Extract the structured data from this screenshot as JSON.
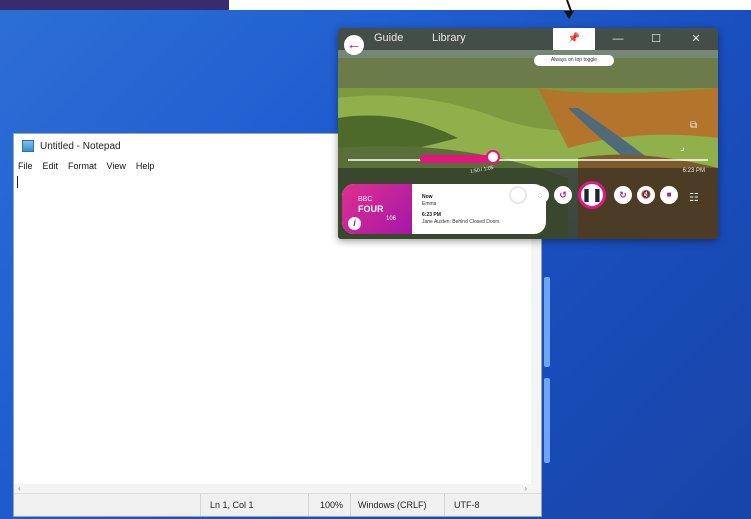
{
  "notepad": {
    "title": "Untitled - Notepad",
    "menu": [
      "File",
      "Edit",
      "Format",
      "View",
      "Help"
    ],
    "status": {
      "position": "Ln 1, Col 1",
      "zoom": "100%",
      "line_ending": "Windows (CRLF)",
      "encoding": "UTF-8"
    }
  },
  "player": {
    "tabs": [
      "Guide",
      "Library"
    ],
    "tooltip": "Always on top toggle",
    "time": "6:23 PM",
    "seek_label": "1:50 / 1:05",
    "station": {
      "line1": "BBC",
      "line2": "FOUR",
      "line3": "106"
    },
    "now_playing": {
      "label_now": "Now",
      "artist": "Emma",
      "time": "6:23 PM",
      "title": "Jane Austen: Behind Closed Doors"
    },
    "icons": {
      "back": "back-arrow-icon",
      "pin": "pin-icon",
      "minimize": "minimize-icon",
      "maximize": "maximize-icon",
      "close": "close-icon",
      "play_pause": "pause-icon",
      "equalizer": "equalizer-icon"
    }
  },
  "colors": {
    "accent": "#e4157f",
    "desktop": "#1f5ed0"
  }
}
